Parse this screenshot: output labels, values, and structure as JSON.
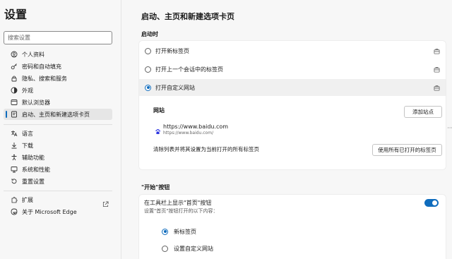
{
  "sidebar": {
    "title": "设置",
    "search_placeholder": "搜索设置",
    "items": [
      {
        "label": "个人资料",
        "icon": "profile-icon"
      },
      {
        "label": "密码和自动填充",
        "icon": "key-icon"
      },
      {
        "label": "隐私、搜索和服务",
        "icon": "lock-icon"
      },
      {
        "label": "外观",
        "icon": "appearance-icon"
      },
      {
        "label": "默认浏览器",
        "icon": "browser-icon"
      },
      {
        "label": "启动、主页和新建选项卡页",
        "icon": "start-page-icon",
        "active": true
      },
      {
        "label": "语言",
        "icon": "language-icon"
      },
      {
        "label": "下载",
        "icon": "download-icon"
      },
      {
        "label": "辅助功能",
        "icon": "accessibility-icon"
      },
      {
        "label": "系统和性能",
        "icon": "system-icon"
      },
      {
        "label": "重置设置",
        "icon": "reset-icon"
      },
      {
        "label": "扩展",
        "icon": "extensions-icon"
      },
      {
        "label": "关于 Microsoft Edge",
        "icon": "edge-icon"
      }
    ]
  },
  "main": {
    "title": "启动、主页和新建选项卡页",
    "startup": {
      "label": "启动时",
      "options": [
        {
          "label": "打开新标签页",
          "selected": false
        },
        {
          "label": "打开上一个会话中的标签页",
          "selected": false
        },
        {
          "label": "打开自定义网站",
          "selected": true
        }
      ],
      "sites_label": "网站",
      "add_site_button": "添加站点",
      "site": {
        "title": "https://www.baidu.com",
        "url": "https://www.baidu.com/",
        "more": "···"
      },
      "clear_text": "清除列表并将其设置为当前打开的所有标签页",
      "use_all_tabs_button": "使用所有已打开的标签页"
    },
    "home_button": {
      "label": "\"开始\"按钮",
      "toggle_label": "在工具栏上显示\"首页\"按钮",
      "toggle_sub": "设置\"首页\"按钮打开的以下内容：",
      "toggle_on": true,
      "options": [
        {
          "label": "新标签页",
          "selected": true
        },
        {
          "label": "设置自定义网站",
          "selected": false
        }
      ]
    }
  },
  "colors": {
    "accent": "#0f6cbd"
  }
}
